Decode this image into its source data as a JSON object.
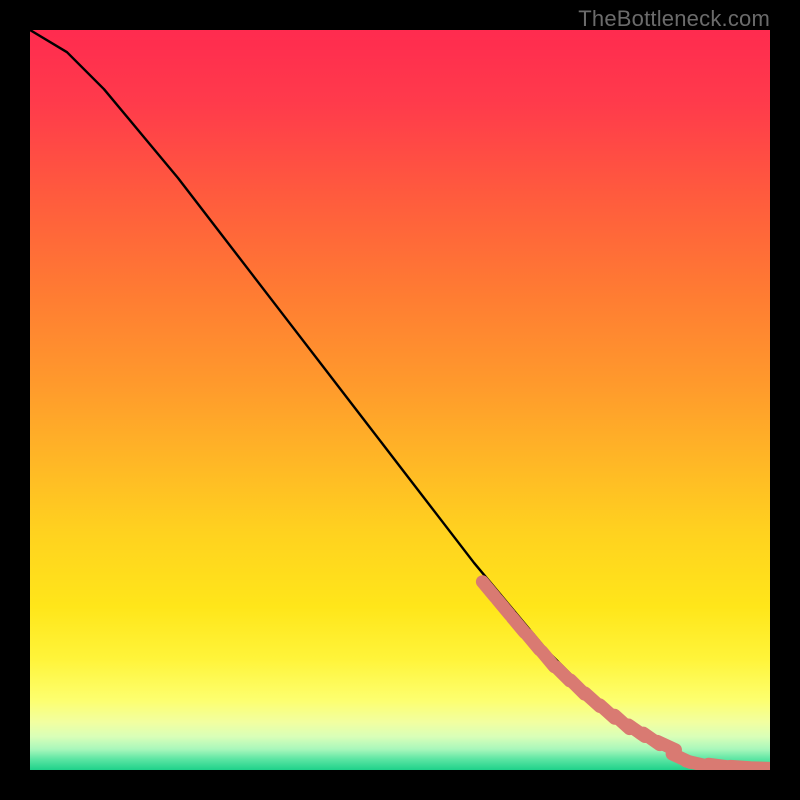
{
  "watermark": "TheBottleneck.com",
  "chart_data": {
    "type": "line",
    "title": "",
    "xlabel": "",
    "ylabel": "",
    "xlim": [
      0,
      100
    ],
    "ylim": [
      0,
      100
    ],
    "curve": {
      "x": [
        0,
        5,
        10,
        15,
        20,
        25,
        30,
        35,
        40,
        45,
        50,
        55,
        60,
        65,
        70,
        75,
        80,
        85,
        88,
        91,
        94,
        97,
        100
      ],
      "y": [
        100,
        97,
        92,
        86,
        80,
        73.5,
        67,
        60.5,
        54,
        47.5,
        41,
        34.5,
        28,
        22,
        16,
        11,
        6.5,
        3,
        1.6,
        0.9,
        0.5,
        0.3,
        0.2
      ]
    },
    "markers": {
      "x": [
        62,
        64,
        66,
        68,
        70,
        72,
        74,
        76,
        78,
        80,
        82,
        84,
        86,
        88,
        90,
        93,
        96,
        99
      ],
      "y": [
        24.4,
        22.0,
        19.6,
        17.3,
        15.0,
        13.0,
        11.2,
        9.5,
        7.9,
        6.5,
        5.3,
        4.2,
        3.3,
        1.6,
        0.9,
        0.6,
        0.4,
        0.25
      ]
    },
    "gradient_stops": [
      {
        "offset": 0,
        "color": "#ff2b4f"
      },
      {
        "offset": 0.1,
        "color": "#ff3b4b"
      },
      {
        "offset": 0.22,
        "color": "#ff5a3e"
      },
      {
        "offset": 0.35,
        "color": "#ff7a33"
      },
      {
        "offset": 0.48,
        "color": "#ff9a2c"
      },
      {
        "offset": 0.58,
        "color": "#ffb626"
      },
      {
        "offset": 0.68,
        "color": "#ffd21f"
      },
      {
        "offset": 0.78,
        "color": "#ffe61a"
      },
      {
        "offset": 0.85,
        "color": "#fff43a"
      },
      {
        "offset": 0.905,
        "color": "#fdff6e"
      },
      {
        "offset": 0.935,
        "color": "#f2ffa0"
      },
      {
        "offset": 0.955,
        "color": "#d9ffb8"
      },
      {
        "offset": 0.972,
        "color": "#a8f7bb"
      },
      {
        "offset": 0.985,
        "color": "#5ee6a4"
      },
      {
        "offset": 1.0,
        "color": "#1fd18a"
      }
    ],
    "marker_color": "#d97a72",
    "curve_color": "#000000"
  }
}
